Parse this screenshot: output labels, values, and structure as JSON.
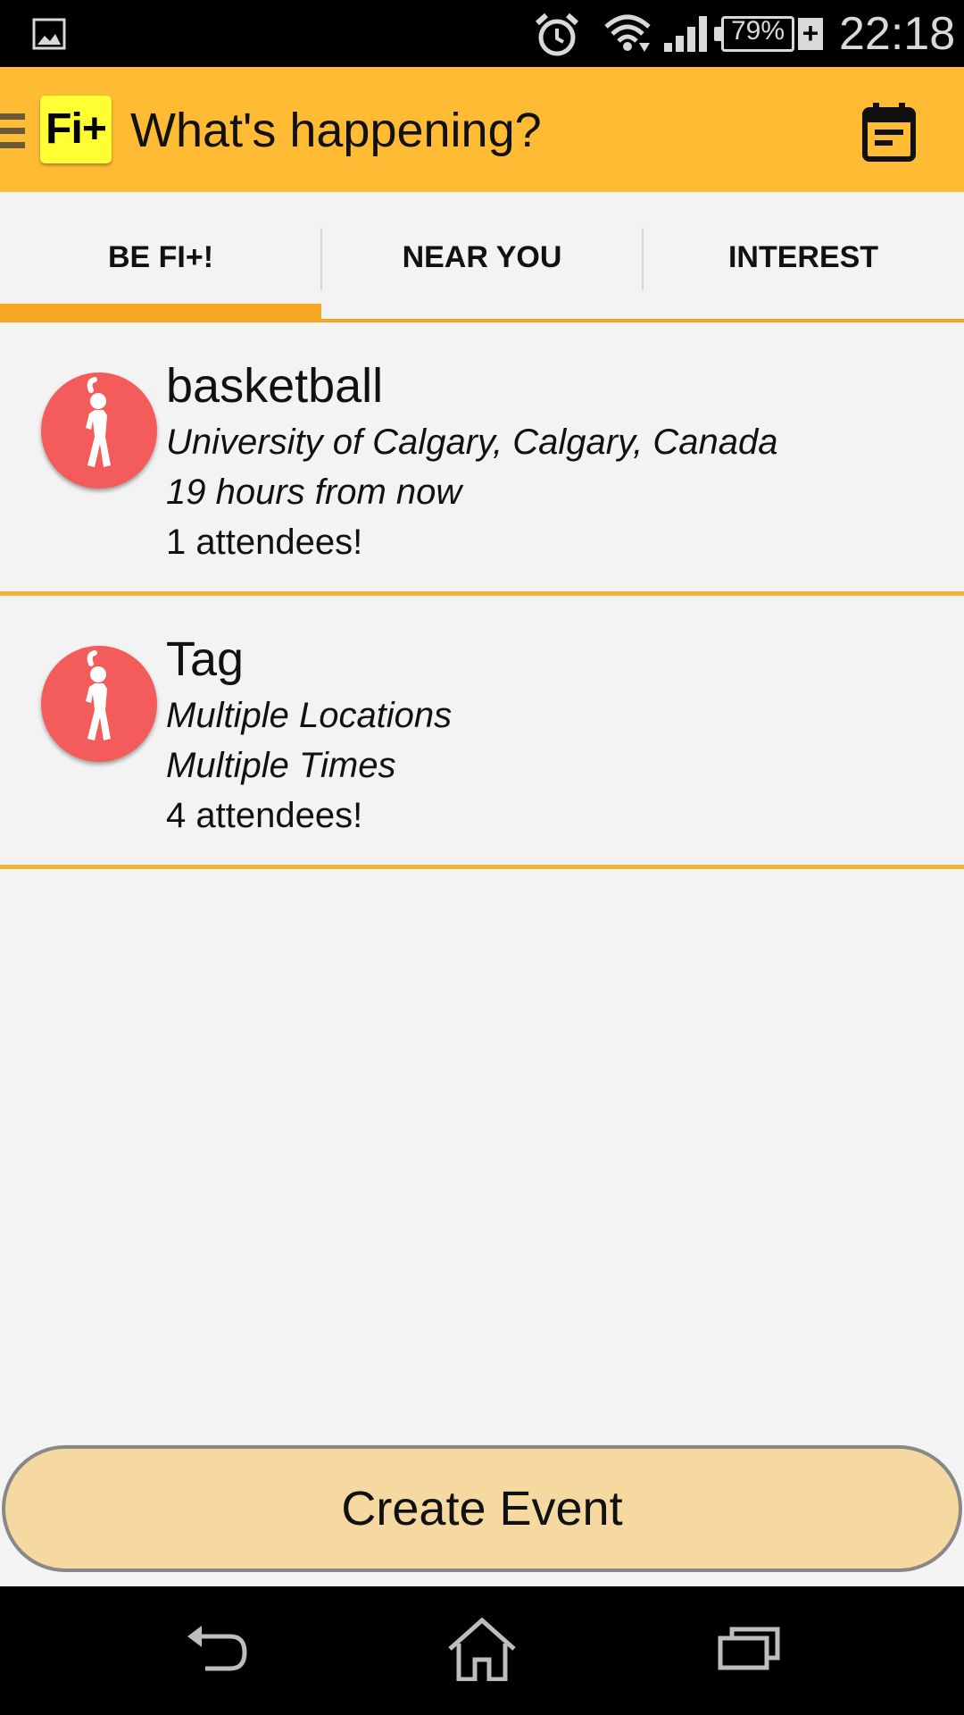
{
  "status_bar": {
    "battery_percent": "79%",
    "time": "22:18"
  },
  "app_bar": {
    "logo": "Fi+",
    "title": "What's happening?"
  },
  "tabs": [
    {
      "label": "BE FI+!",
      "selected": true
    },
    {
      "label": "NEAR YOU",
      "selected": false
    },
    {
      "label": "INTEREST",
      "selected": false
    }
  ],
  "events": [
    {
      "name": "basketball",
      "location": "University of Calgary, Calgary, Canada",
      "time": "19 hours from now",
      "attendees": "1 attendees!"
    },
    {
      "name": "Tag",
      "location": "Multiple Locations",
      "time": "Multiple Times",
      "attendees": "4 attendees!"
    }
  ],
  "create_button": {
    "label": "Create Event"
  },
  "colors": {
    "app_bar": "#ffbb33",
    "accent": "#f5a623",
    "avatar": "#f45b5b",
    "button": "#f5d9a0",
    "logo": "#ffff33"
  },
  "icons": {
    "status": [
      "gallery-icon",
      "alarm-icon",
      "wifi-icon",
      "signal-icon",
      "battery-icon",
      "charging-icon"
    ],
    "app_bar": [
      "menu-icon",
      "calendar-icon"
    ],
    "event": "stretch-person-icon",
    "nav": [
      "back-icon",
      "home-icon",
      "recents-icon"
    ]
  }
}
